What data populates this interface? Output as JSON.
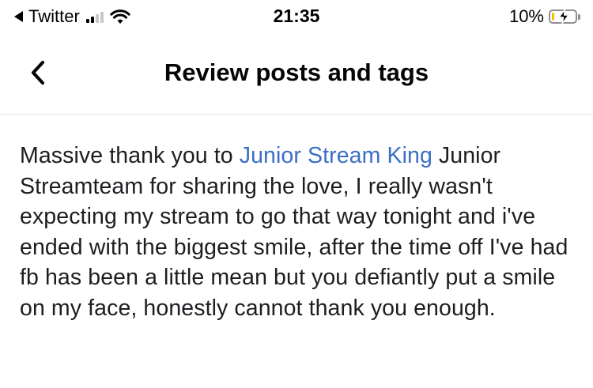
{
  "status_bar": {
    "back_app": "Twitter",
    "time": "21:35",
    "battery_percent": "10%",
    "battery_level": 0.1,
    "battery_color": "#f2c200",
    "signal_bars": 2,
    "icons": [
      "back-triangle-icon",
      "cellular-signal-icon",
      "wifi-icon",
      "battery-charging-icon"
    ]
  },
  "header": {
    "title": "Review posts and tags",
    "back_icon": "chevron-left-icon"
  },
  "post": {
    "text_before": "Massive thank you to ",
    "mention": "Junior Stream King",
    "text_after": " Junior Streamteam for sharing the love, I really wasn't expecting my stream to go that way tonight and i've ended with the biggest smile, after the time off I've had fb has been a little mean but you defiantly put a smile on my face, honestly cannot thank you enough.",
    "mention_color": "#3b6fc4"
  }
}
